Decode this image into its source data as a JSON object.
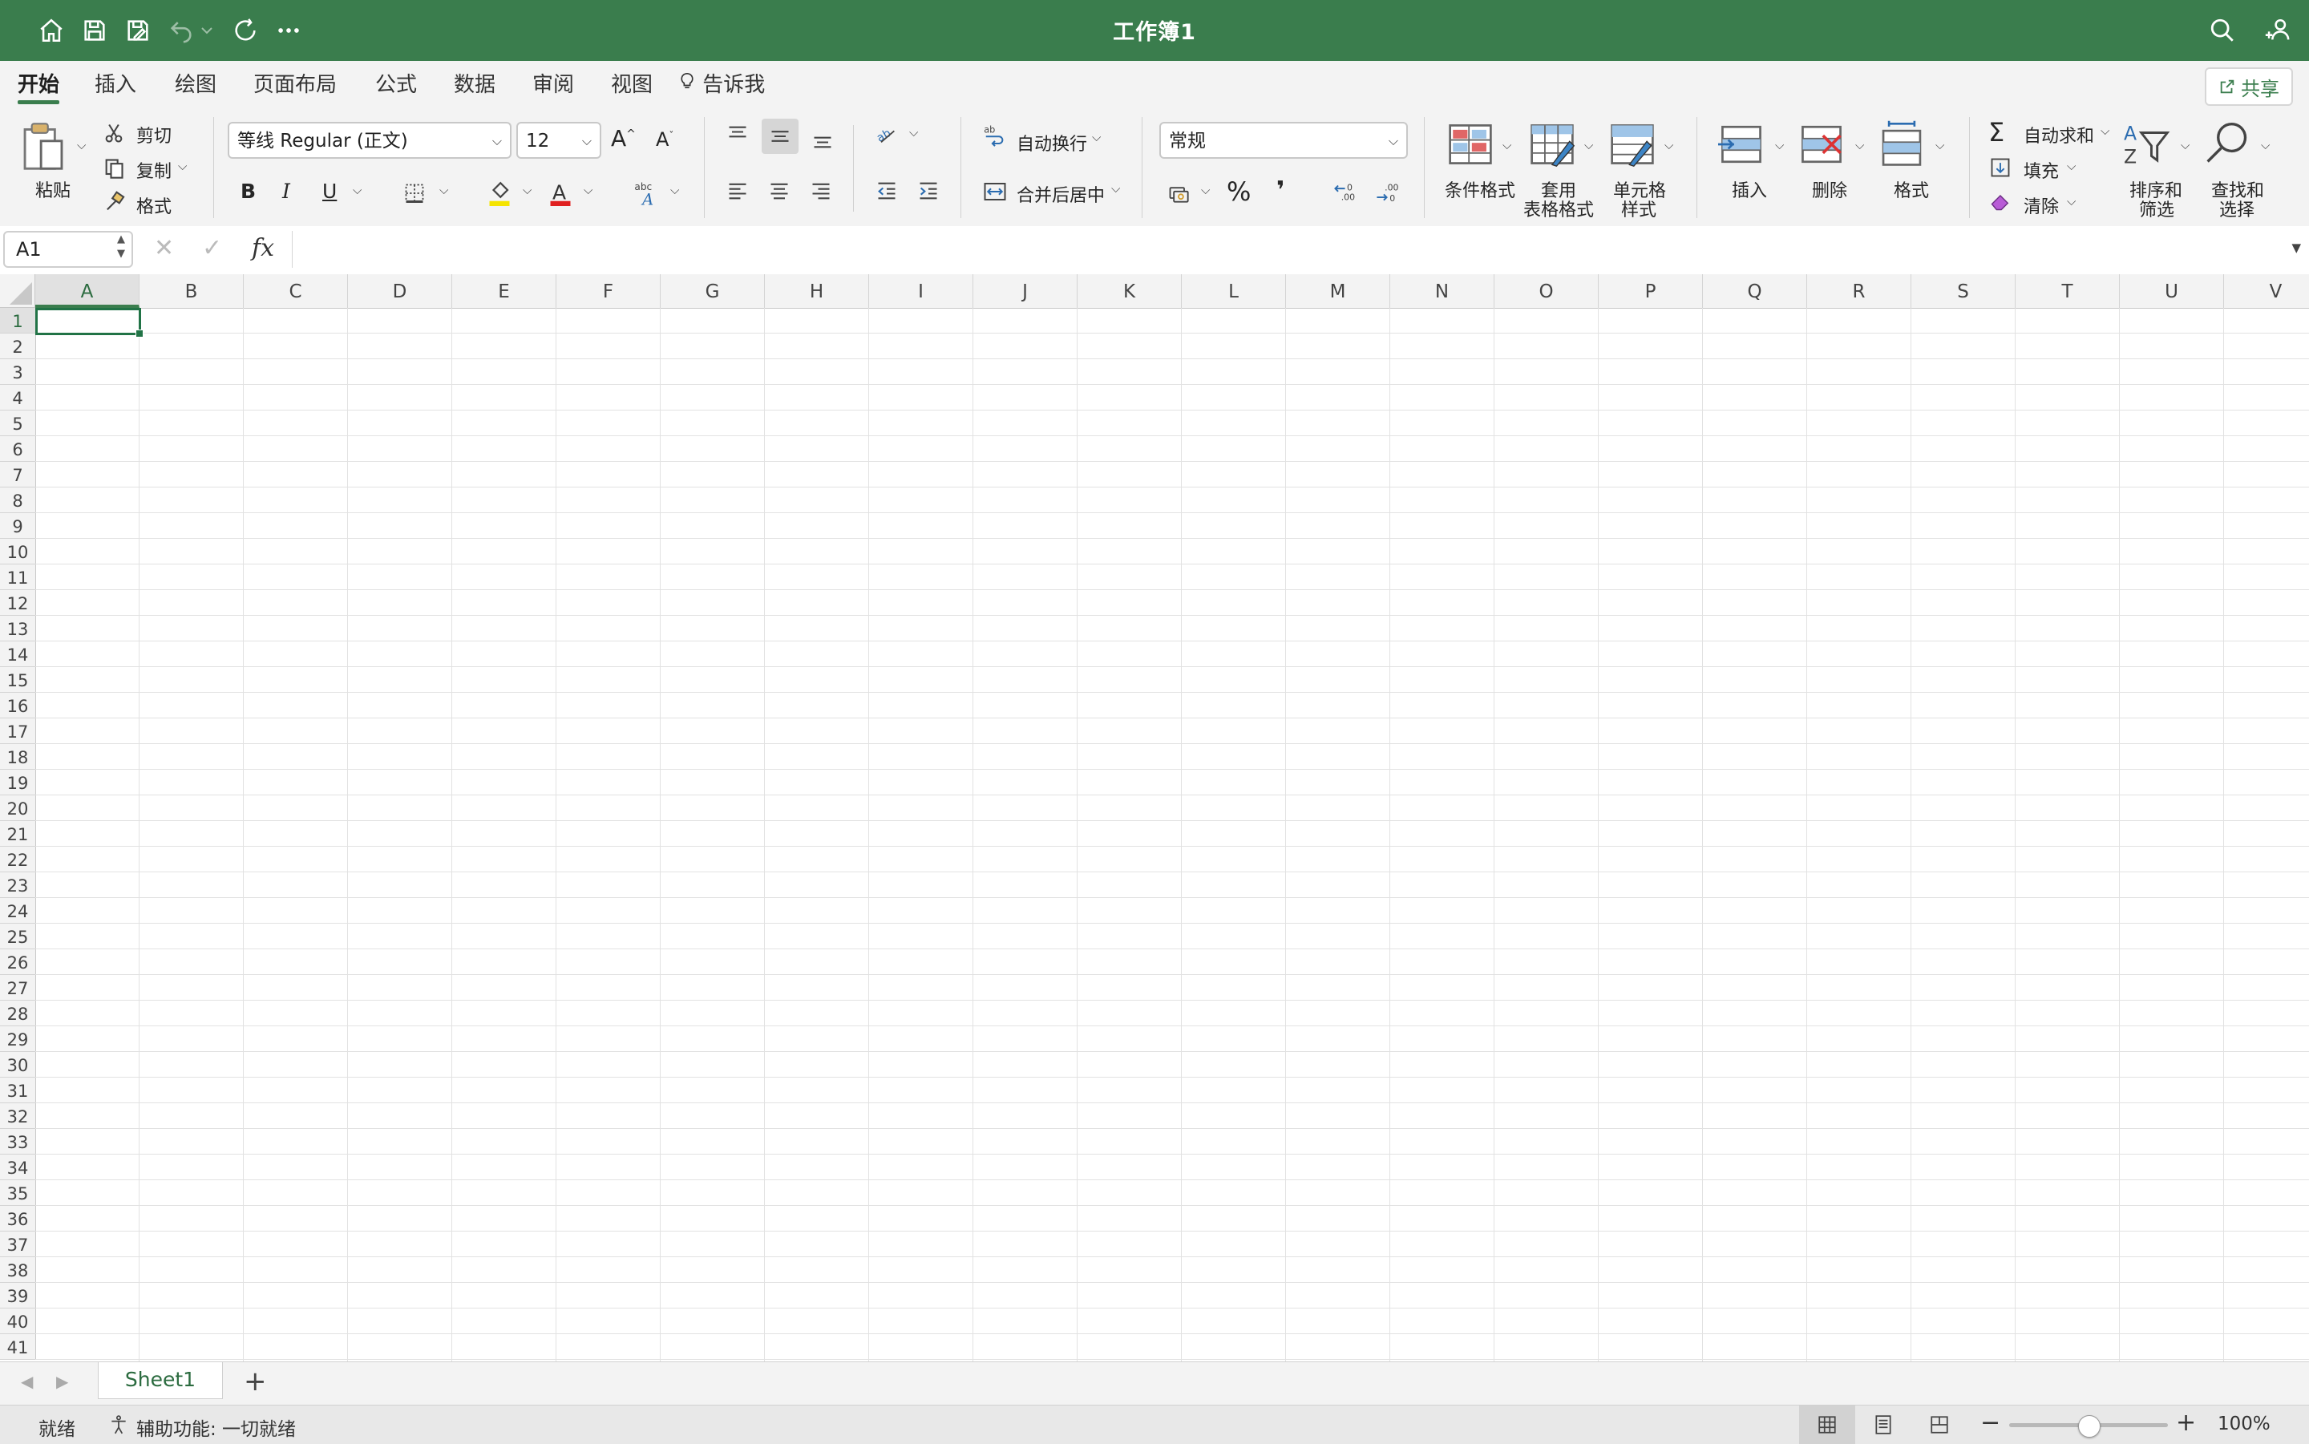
{
  "window": {
    "title": "工作簿1"
  },
  "tabs": [
    {
      "label": "开始",
      "active": true
    },
    {
      "label": "插入"
    },
    {
      "label": "绘图"
    },
    {
      "label": "页面布局"
    },
    {
      "label": "公式"
    },
    {
      "label": "数据"
    },
    {
      "label": "审阅"
    },
    {
      "label": "视图"
    }
  ],
  "tell_me": "告诉我",
  "share_label": "共享",
  "ribbon": {
    "clipboard": {
      "paste": "粘贴",
      "cut": "剪切",
      "copy": "复制",
      "format_painter": "格式"
    },
    "font": {
      "name": "等线 Regular (正文)",
      "size": "12",
      "bold": "B",
      "italic": "I",
      "underline": "U"
    },
    "alignment": {
      "wrap_text": "自动换行",
      "merge_center": "合并后居中"
    },
    "number": {
      "format": "常规",
      "percent": "%",
      "comma": "❜"
    },
    "styles": {
      "conditional": "条件格式",
      "table_format_1": "套用",
      "table_format_2": "表格格式",
      "cell_style_1": "单元格",
      "cell_style_2": "样式"
    },
    "cells": {
      "insert": "插入",
      "delete": "删除",
      "format": "格式"
    },
    "editing": {
      "autosum": "自动求和",
      "fill": "填充",
      "clear": "清除",
      "sort_1": "排序和",
      "sort_2": "筛选",
      "find_1": "查找和",
      "find_2": "选择"
    }
  },
  "formula_bar": {
    "name_box": "A1",
    "fx": "fx",
    "value": ""
  },
  "columns": [
    "A",
    "B",
    "C",
    "D",
    "E",
    "F",
    "G",
    "H",
    "I",
    "J",
    "K",
    "L",
    "M",
    "N",
    "O",
    "P",
    "Q",
    "R",
    "S",
    "T",
    "U",
    "V"
  ],
  "rows": [
    "1",
    "2",
    "3",
    "4",
    "5",
    "6",
    "7",
    "8",
    "9",
    "10",
    "11",
    "12",
    "13",
    "14",
    "15",
    "16",
    "17",
    "18",
    "19",
    "20",
    "21",
    "22",
    "23",
    "24",
    "25",
    "26",
    "27",
    "28",
    "29",
    "30",
    "31",
    "32",
    "33",
    "34",
    "35",
    "36",
    "37",
    "38",
    "39",
    "40",
    "41"
  ],
  "active_cell": "A1",
  "sheets": [
    {
      "name": "Sheet1",
      "active": true
    }
  ],
  "status": {
    "ready": "就绪",
    "accessibility": "辅助功能: 一切就绪",
    "zoom": "100%",
    "zoom_value_percent": 100
  },
  "colors": {
    "accent": "#3a7d4d",
    "active_border": "#217346"
  }
}
